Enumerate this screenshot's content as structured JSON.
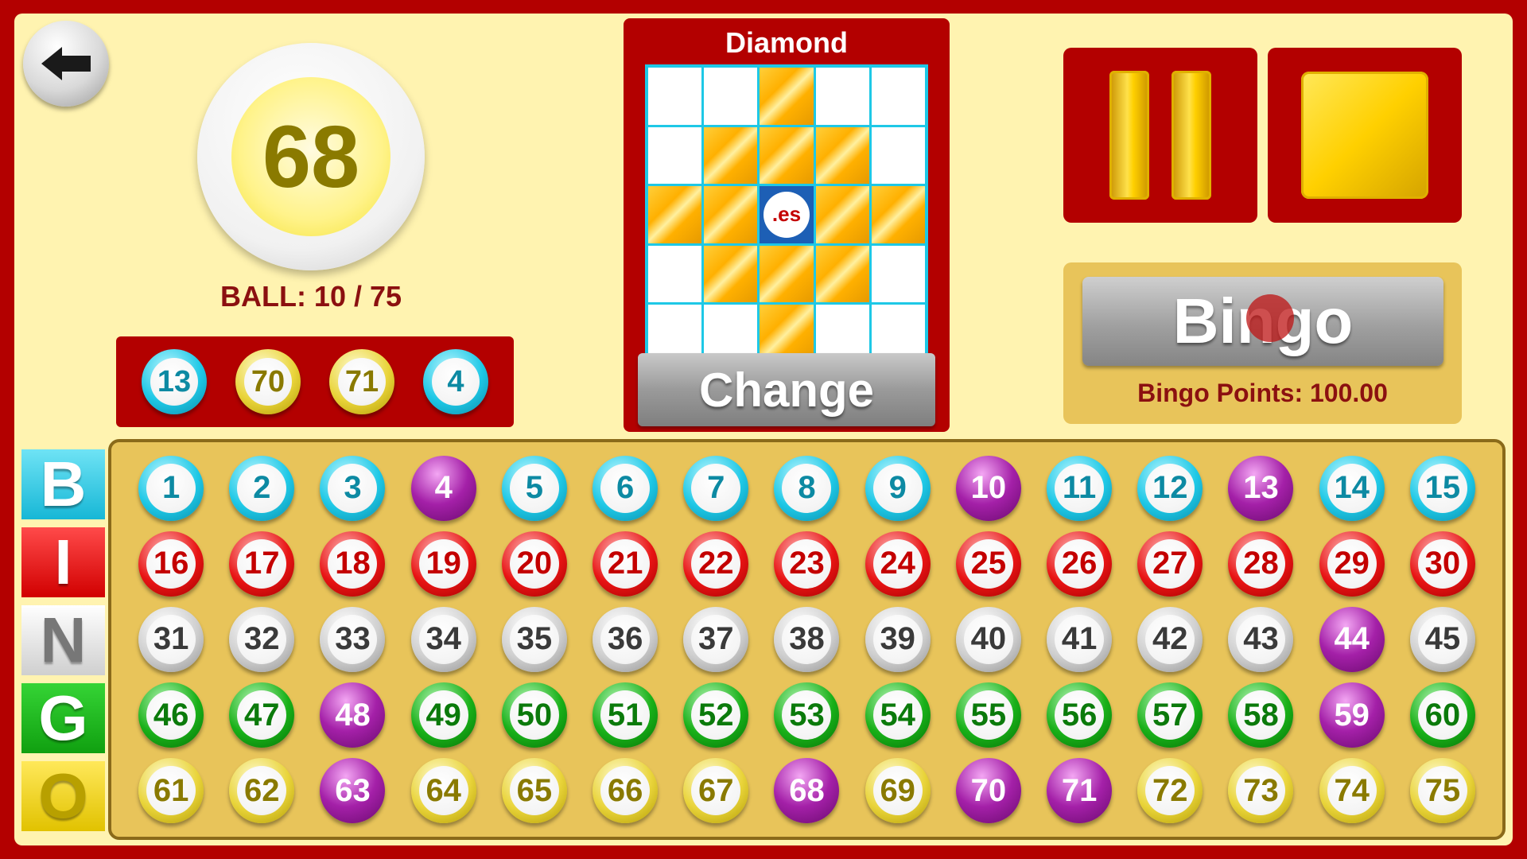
{
  "current_ball": {
    "number": "68",
    "label": "BALL: 10 / 75"
  },
  "recent_balls": [
    {
      "number": "13",
      "color": "b"
    },
    {
      "number": "70",
      "color": "o"
    },
    {
      "number": "71",
      "color": "o"
    },
    {
      "number": "4",
      "color": "b"
    }
  ],
  "pattern": {
    "title": "Diamond",
    "free_label": ".es",
    "cells": [
      [
        0,
        0,
        1,
        0,
        0
      ],
      [
        0,
        1,
        1,
        1,
        0
      ],
      [
        1,
        1,
        2,
        1,
        1
      ],
      [
        0,
        1,
        1,
        1,
        0
      ],
      [
        0,
        0,
        1,
        0,
        0
      ]
    ],
    "change_label": "Change"
  },
  "controls": {
    "pause_icon": "pause-icon",
    "stop_icon": "stop-icon"
  },
  "bingo": {
    "button_label": "Bingo",
    "points_label": "Bingo Points: 100.00"
  },
  "letters": [
    "B",
    "I",
    "N",
    "G",
    "O"
  ],
  "board": {
    "called": [
      4,
      10,
      13,
      44,
      48,
      59,
      63,
      68,
      70,
      71
    ],
    "colors": {
      "called": "#a420a8",
      "b": "#1ec8e6",
      "i": "#e81414",
      "n": "#cfcfcf",
      "g": "#18b018",
      "o": "#e9d43a"
    }
  }
}
